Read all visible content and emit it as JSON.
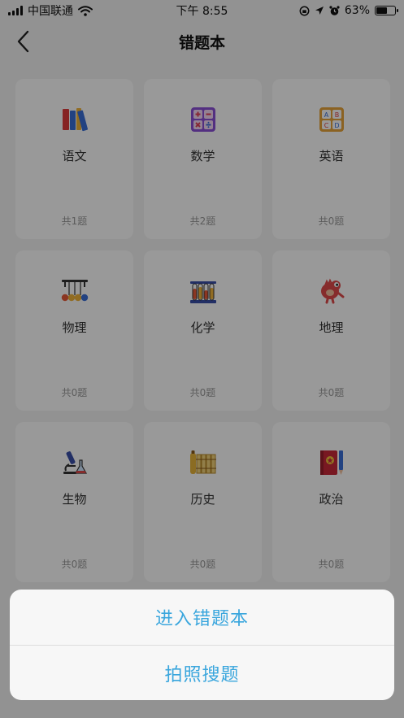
{
  "status_bar": {
    "carrier": "中国联通",
    "time": "下午 8:55",
    "battery_percent": "63%",
    "battery_level": 0.63
  },
  "nav": {
    "title": "错题本",
    "back_icon": "chevron-left-icon"
  },
  "subjects": [
    {
      "name": "语文",
      "count": "共1题",
      "icon": "books-icon"
    },
    {
      "name": "数学",
      "count": "共2题",
      "icon": "calculator-icon"
    },
    {
      "name": "英语",
      "count": "共0题",
      "icon": "abcd-blocks-icon"
    },
    {
      "name": "物理",
      "count": "共0题",
      "icon": "newton-cradle-icon"
    },
    {
      "name": "化学",
      "count": "共0题",
      "icon": "test-tubes-icon"
    },
    {
      "name": "地理",
      "count": "共0题",
      "icon": "dinosaur-icon"
    },
    {
      "name": "生物",
      "count": "共0题",
      "icon": "microscope-icon"
    },
    {
      "name": "历史",
      "count": "共0题",
      "icon": "bamboo-scroll-icon"
    },
    {
      "name": "政治",
      "count": "共0题",
      "icon": "red-book-icon"
    }
  ],
  "action_sheet": {
    "items": [
      {
        "label": "进入错题本"
      },
      {
        "label": "拍照搜题"
      }
    ],
    "accent": "#3aa6dd"
  },
  "overlay": {
    "dim_color": "rgba(0,0,0,0.4)"
  }
}
